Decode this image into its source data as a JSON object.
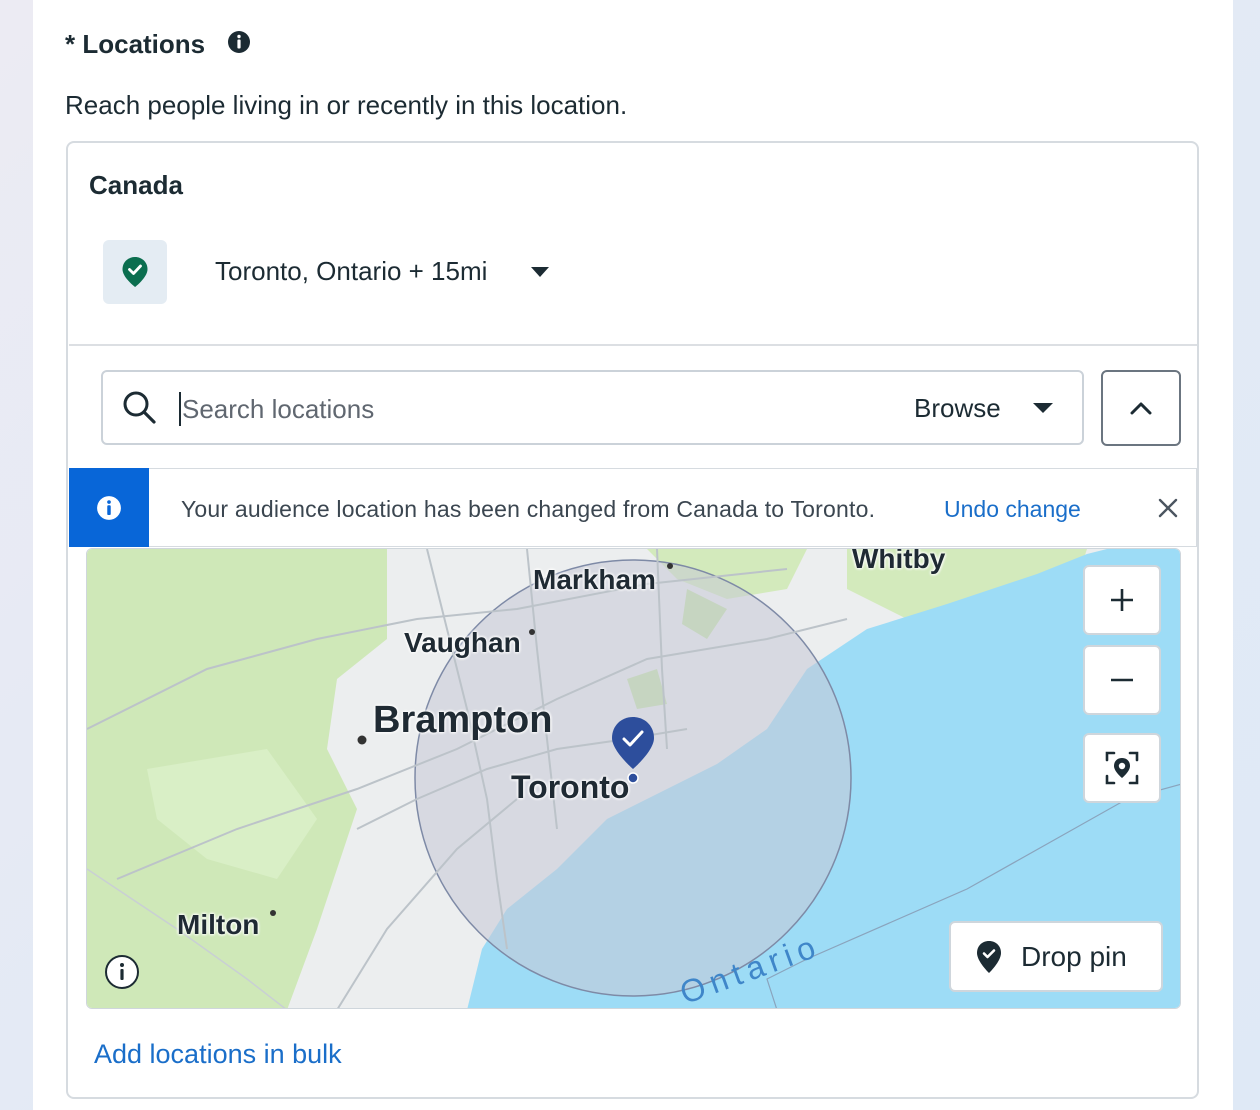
{
  "section": {
    "title": "* Locations",
    "subtitle": "Reach people living in or recently in this location."
  },
  "selection": {
    "country": "Canada",
    "location_label": "Toronto, Ontario + 15mi"
  },
  "search": {
    "placeholder": "Search locations",
    "value": "",
    "browse_label": "Browse"
  },
  "banner": {
    "message": "Your audience location has been changed from Canada to Toronto.",
    "link_label": "Undo change"
  },
  "map": {
    "cities": {
      "whitby": "Whitby",
      "markham": "Markham",
      "vaughan": "Vaughan",
      "brampton": "Brampton",
      "toronto": "Toronto",
      "milton": "Milton"
    },
    "lake_label": "Ontario",
    "drop_pin_label": "Drop pin",
    "radius": "15mi"
  },
  "footer": {
    "bulk_link": "Add locations in bulk"
  },
  "colors": {
    "accent": "#0866d8",
    "link": "#1a6ec9",
    "pin_green": "#0b6e4f",
    "map_pin": "#2d4e9c",
    "water": "#9ddcf6",
    "land": "#eceeef",
    "park": "#cfe8b8"
  }
}
